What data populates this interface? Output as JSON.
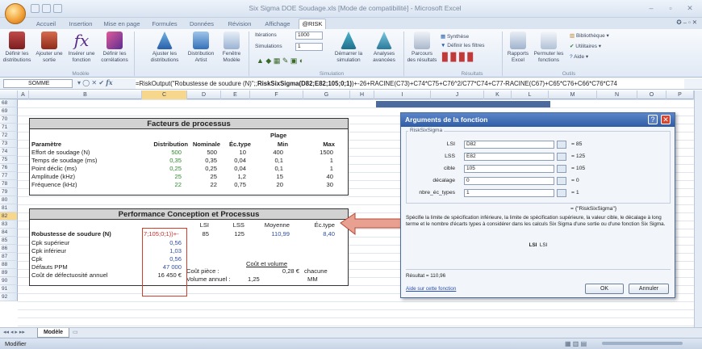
{
  "window": {
    "title": "Six Sigma DOE Soudage.xls [Mode de compatibilité] - Microsoft Excel"
  },
  "ribbon_tabs": [
    "Accueil",
    "Insertion",
    "Mise en page",
    "Formules",
    "Données",
    "Révision",
    "Affichage",
    "@RISK"
  ],
  "active_tab": "@RISK",
  "ribbon": {
    "modele": {
      "label": "Modèle",
      "buttons": [
        "Définir les distributions",
        "Ajouter une sortie",
        "Insérer une fonction",
        "Définir les corrélations"
      ]
    },
    "tools": [
      "Ajuster les distributions",
      "Distribution Artist",
      "Fenêtre Modèle"
    ],
    "simulation": {
      "label": "Simulation",
      "iterations_label": "Itérations",
      "iterations_value": "1000",
      "simulations_label": "Simulations",
      "simulations_value": "1",
      "start_btn": "Démarrer la simulation",
      "advanced_btn": "Analyses avancées"
    },
    "resultats": {
      "label": "Résultats",
      "browse_btn": "Parcours des résultats",
      "synthese": "Synthèse",
      "filtres": "Définir les filtres",
      "excel_reports": "Rapports Excel",
      "swap": "Permuter les fonctions"
    },
    "outils": {
      "label": "Outils",
      "library": "Bibliothèque",
      "utilities": "Utilitaires",
      "help": "Aide"
    }
  },
  "formula_bar": {
    "name_box": "SOMME",
    "formula_pre": "=RiskOutput(\"Robustesse de soudure (N)\";;",
    "formula_bold": "RiskSixSigma(D82;E82;105;0;1)",
    "formula_post": ")+-26+RACINE(C73)+C74*C75+C76^2/C77*C74+C77-RACINE(C67)+C65*C76+C66*C76*C74"
  },
  "columns": [
    "A",
    "B",
    "C",
    "D",
    "E",
    "F",
    "G",
    "H",
    "I",
    "J",
    "K",
    "L",
    "M",
    "N",
    "O",
    "P"
  ],
  "rows": [
    "68",
    "69",
    "70",
    "71",
    "72",
    "73",
    "74",
    "75",
    "76",
    "77",
    "78",
    "79",
    "80",
    "81",
    "82",
    "83",
    "84",
    "85",
    "86",
    "87",
    "88",
    "89",
    "90",
    "91",
    "92"
  ],
  "process_table": {
    "title": "Facteurs de processus",
    "plage": "Plage",
    "headers": [
      "Paramètre",
      "Distribution",
      "Nominale",
      "Éc.type",
      "Min",
      "Max"
    ],
    "rows": [
      [
        "Effort de soudage (N)",
        "500",
        "500",
        "10",
        "400",
        "1500"
      ],
      [
        "Temps de soudage (ms)",
        "0,35",
        "0,35",
        "0,04",
        "0,1",
        "1"
      ],
      [
        "Point déclic (ms)",
        "0,25",
        "0,25",
        "0,04",
        "0,1",
        "1"
      ],
      [
        "Amplitude (kHz)",
        "25",
        "25",
        "1,2",
        "15",
        "40"
      ],
      [
        "Fréquence (kHz)",
        "22",
        "22",
        "0,75",
        "20",
        "30"
      ]
    ]
  },
  "perf_table": {
    "title": "Performance Conception et Processus",
    "headers": [
      "LSI",
      "LSS",
      "Moyenne",
      "Éc.type"
    ],
    "main_label": "Robustesse de soudure (N)",
    "main_cell": "7;105;0;1))+-",
    "main_vals": [
      "85",
      "125",
      "110,99",
      "8,40"
    ],
    "rows": [
      [
        "Cpk supérieur",
        "0,56"
      ],
      [
        "Cpk inférieur",
        "1,03"
      ],
      [
        "Cpk",
        "0,56"
      ],
      [
        "Défauts PPM",
        "47 000"
      ],
      [
        "Coût de défectuosité annuel",
        "16 450 €"
      ]
    ],
    "cost_title": "Coût et volume",
    "cost_piece_label": "Coût pièce :",
    "cost_piece_value": "0,28 €",
    "cost_piece_unit": "chacune",
    "volume_label": "Volume annuel :",
    "volume_value": "1,25",
    "volume_unit": "MM"
  },
  "sheet_tab": "Modèle",
  "status": "Modifier",
  "dialog": {
    "title": "Arguments de la fonction",
    "function": "RiskSixSigma",
    "args": [
      {
        "label": "LSI",
        "value": "D82",
        "result": "= 85"
      },
      {
        "label": "LSS",
        "value": "E82",
        "result": "= 125"
      },
      {
        "label": "cible",
        "value": "105",
        "result": "= 105"
      },
      {
        "label": "décalage",
        "value": "0",
        "result": "= 0"
      },
      {
        "label": "nbre_éc_types",
        "value": "1",
        "result": "= 1"
      }
    ],
    "return_value": "= {\"RiskSixSigma\"}",
    "description": "Spécifie la limite de spécification inférieure, la limite de spécification supérieure, la valeur cible, le décalage à long terme et le nombre d'écarts types à considérer dans les calculs Six Sigma d'une sortie ou d'une fonction Six Sigma.",
    "arg_name": "LSI",
    "arg_desc": "LSI",
    "result": "Résultat = 110,96",
    "help_link": "Aide sur cette fonction",
    "ok": "OK",
    "cancel": "Annuler"
  }
}
